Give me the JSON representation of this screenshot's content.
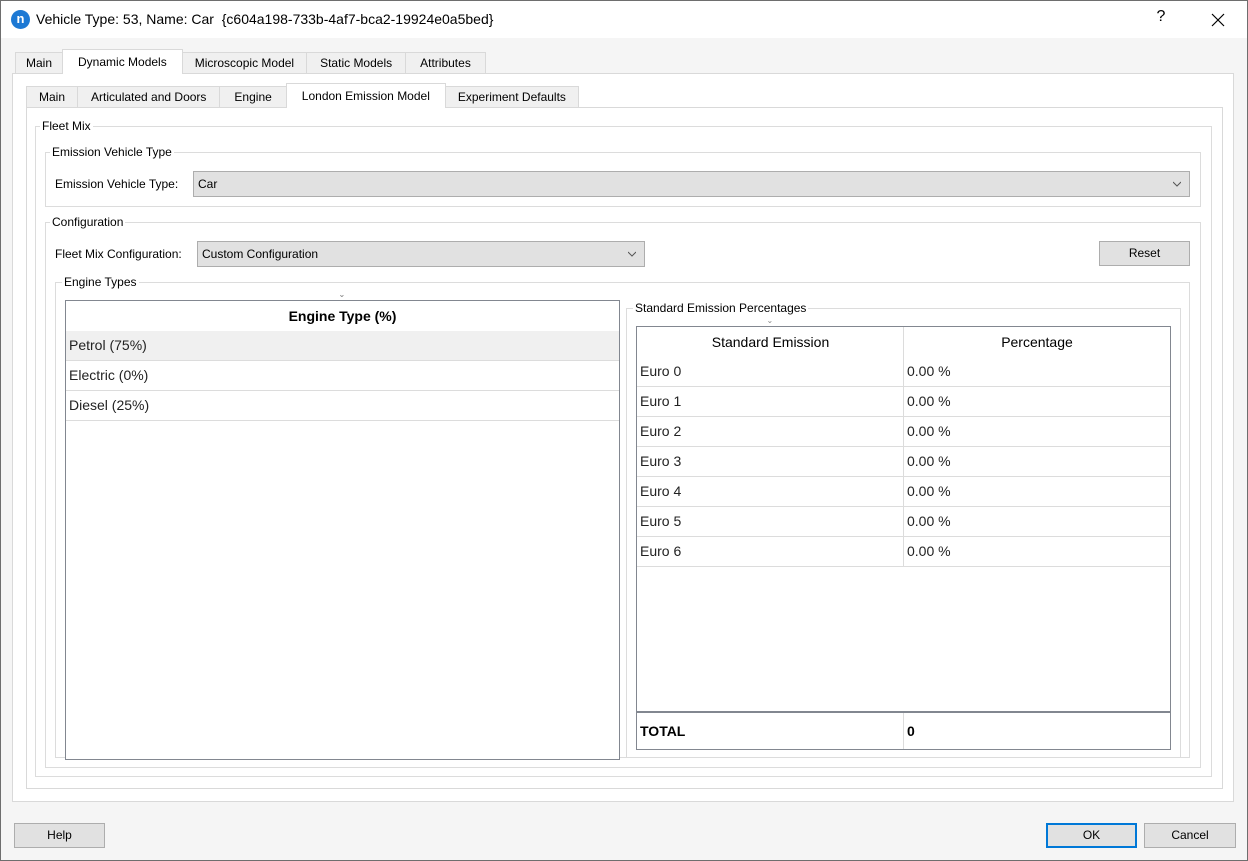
{
  "window": {
    "title": "Vehicle Type: 53, Name: Car  {c604a198-733b-4af7-bca2-19924e0a5bed}",
    "app_icon_glyph": "n",
    "help_glyph": "?",
    "close_icon": "close-icon"
  },
  "main_tabs": [
    {
      "label": "Main",
      "active": false
    },
    {
      "label": "Dynamic Models",
      "active": true
    },
    {
      "label": "Microscopic Model",
      "active": false
    },
    {
      "label": "Static Models",
      "active": false
    },
    {
      "label": "Attributes",
      "active": false
    }
  ],
  "sub_tabs": [
    {
      "label": "Main",
      "active": false
    },
    {
      "label": "Articulated and Doors",
      "active": false
    },
    {
      "label": "Engine",
      "active": false
    },
    {
      "label": "London Emission Model",
      "active": true
    },
    {
      "label": "Experiment Defaults",
      "active": false
    }
  ],
  "fleet_mix": {
    "group_label": "Fleet Mix",
    "emission_vehicle_type": {
      "group_label": "Emission Vehicle Type",
      "field_label": "Emission Vehicle Type:",
      "value": "Car"
    },
    "configuration": {
      "group_label": "Configuration",
      "field_label": "Fleet Mix Configuration:",
      "value": "Custom Configuration",
      "reset_label": "Reset"
    },
    "engine_types": {
      "group_label": "Engine Types",
      "column_header": "Engine Type (%)",
      "rows": [
        {
          "label": "Petrol (75%)",
          "selected": true
        },
        {
          "label": "Electric (0%)",
          "selected": false
        },
        {
          "label": "Diesel (25%)",
          "selected": false
        }
      ]
    },
    "standard_emissions": {
      "group_label": "Standard Emission Percentages",
      "columns": [
        "Standard Emission",
        "Percentage"
      ],
      "rows": [
        {
          "name": "Euro 0",
          "pct": "0.00 %"
        },
        {
          "name": "Euro 1",
          "pct": "0.00 %"
        },
        {
          "name": "Euro 2",
          "pct": "0.00 %"
        },
        {
          "name": "Euro 3",
          "pct": "0.00 %"
        },
        {
          "name": "Euro 4",
          "pct": "0.00 %"
        },
        {
          "name": "Euro 5",
          "pct": "0.00 %"
        },
        {
          "name": "Euro 6",
          "pct": "0.00 %"
        }
      ],
      "total_label": "TOTAL",
      "total_value": "0"
    }
  },
  "footer": {
    "help_label": "Help",
    "ok_label": "OK",
    "cancel_label": "Cancel"
  },
  "colors": {
    "accent": "#0078d7",
    "app_icon": "#1d79d4"
  }
}
